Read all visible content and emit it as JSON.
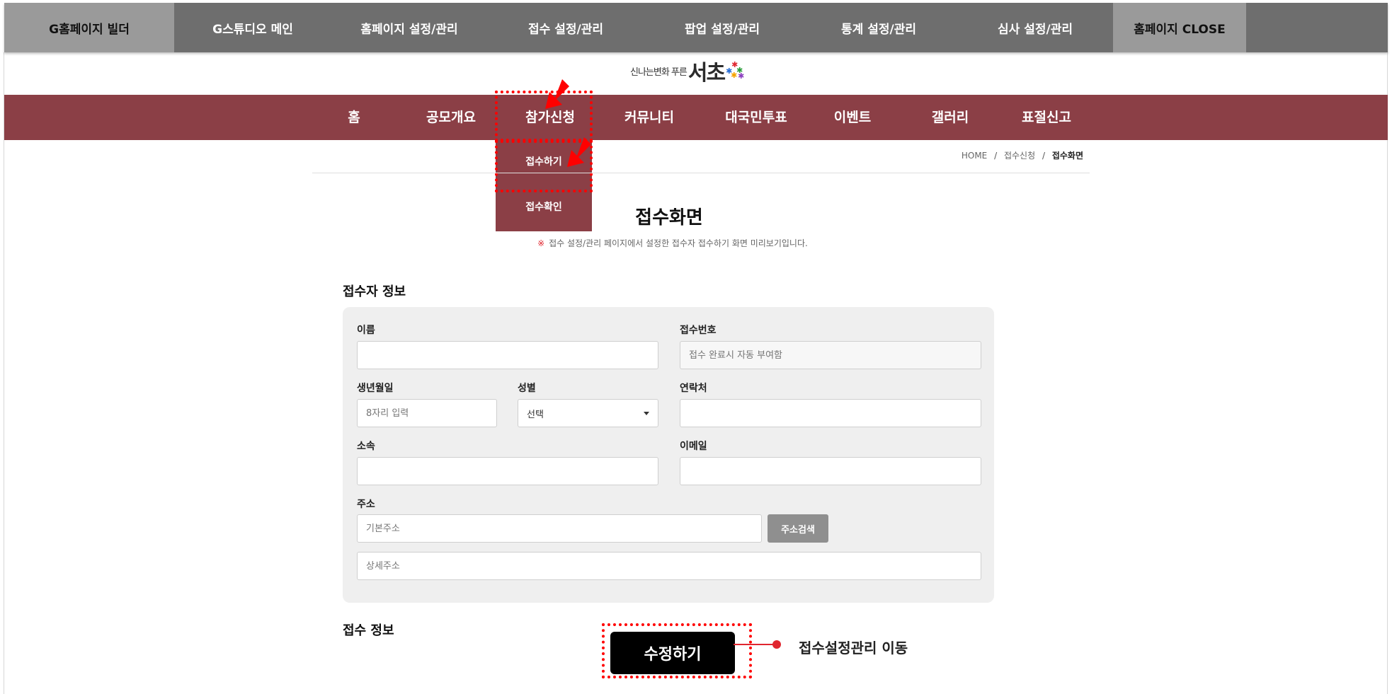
{
  "admin_bar": {
    "items": [
      "G홈페이지 빌더",
      "G스튜디오 메인",
      "홈페이지 설정/관리",
      "접수 설정/관리",
      "팝업 설정/관리",
      "통계 설정/관리",
      "심사 설정/관리",
      "홈페이지 CLOSE"
    ]
  },
  "logo": {
    "slogan": "신나는변화 푸른",
    "name": "서초",
    "star_colors": [
      "#e0262f",
      "#2a9d3a",
      "#2a6fd6",
      "#f5a400",
      "#8b3fbf"
    ]
  },
  "main_nav": {
    "items": [
      "홈",
      "공모개요",
      "참가신청",
      "커뮤니티",
      "대국민투표",
      "이벤트",
      "갤러리",
      "표절신고"
    ]
  },
  "dropdown": {
    "items": [
      "접수하기",
      "접수확인"
    ]
  },
  "breadcrumb": {
    "home": "HOME",
    "level1": "접수신청",
    "current": "접수화면",
    "separator": "/"
  },
  "page": {
    "title": "접수화면",
    "notice_mark": "※",
    "notice": "접수 설정/관리 페이지에서 설정한 접수자 접수하기 화면 미리보기입니다."
  },
  "applicant_section": {
    "title": "접수자 정보"
  },
  "form": {
    "name_label": "이름",
    "receipt_no_label": "접수번호",
    "receipt_no_placeholder": "접수 완료시 자동 부여함",
    "birth_label": "생년월일",
    "birth_placeholder": "8자리 입력",
    "gender_label": "성별",
    "gender_value": "선택",
    "phone_label": "연락처",
    "affiliation_label": "소속",
    "email_label": "이메일",
    "address_label": "주소",
    "address_base_placeholder": "기본주소",
    "address_search_label": "주소검색",
    "address_detail_placeholder": "상세주소"
  },
  "receipt_section": {
    "title": "접수 정보"
  },
  "edit_button": {
    "label": "수정하기"
  },
  "callout": {
    "text": "접수설정관리 이동"
  },
  "colors": {
    "nav_bg": "#8b3f46",
    "admin_bar_bg": "#6e6e6e",
    "highlight": "#ff0000",
    "button_bg": "#000000"
  }
}
